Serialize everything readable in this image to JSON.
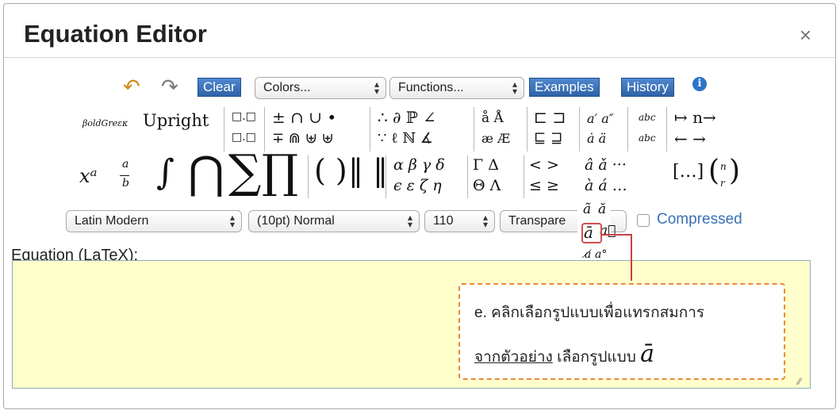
{
  "dialog": {
    "title": "Equation Editor",
    "close_label": "×"
  },
  "toolbar": {
    "undo_icon": "↶",
    "redo_icon": "↷",
    "clear_label": "Clear",
    "colors_label": "Colors...",
    "functions_label": "Functions...",
    "examples_label": "Examples",
    "history_label": "History",
    "info_label": "i"
  },
  "symbols": {
    "bold_greek": "βoldGreεκ",
    "upright": "Upright",
    "row1": {
      "boxes": "□.□",
      "ops1": "± ∩ ∪ •",
      "logic1": "∴ ∂ ℙ ∠",
      "accents1": "å Å",
      "brackets1": "⊏ ⊐",
      "primes": "a′ a″",
      "wide1": "abc",
      "arrows1": "↦ n→"
    },
    "row2": {
      "boxes": "□.□",
      "ops2": "∓ ⋒ ⊎ ⊎",
      "logic2": "∵ ℓ ℕ ∡",
      "accents2": "æ Æ",
      "brackets2": "⊑ ⊒",
      "dots": "ȧ ä",
      "wide2": "abc",
      "arrows2": "← →"
    },
    "big": {
      "power": "xᵃ",
      "frac_num": "a",
      "frac_den": "b",
      "integral": "∫",
      "cap": "⋂",
      "sum": "∑",
      "prod": "∏",
      "parens": "( )",
      "bars": "‖ ‖",
      "greek_top": "α β γ δ",
      "greek_bot": "ϵ ε ζ η",
      "capgreek_top": "Γ Δ",
      "capgreek_bot": "Θ Λ",
      "ineq_top": "< >",
      "ineq_bot": "≤ ≥",
      "acc_top": "â ǎ ···",
      "acc_bot": "à á …",
      "matrix": "[…]",
      "binom_top": "n",
      "binom_bot": "r"
    },
    "popup": {
      "tilde_a": "ã",
      "breve_a": "ă",
      "bar_a": "ā",
      "vec_a": "a⃗",
      "slash_a": "a̸",
      "deg_a": "a°"
    }
  },
  "options": {
    "font": "Latin Modern",
    "size": "(10pt) Normal",
    "dpi": "110",
    "background": "Transpare",
    "compressed_label": "Compressed",
    "compressed_checked": false
  },
  "equation": {
    "label": "Equation (LaTeX):",
    "value": ""
  },
  "callout": {
    "line1": "e. คลิกเลือกรูปแบบเพื่อแทรกสมการ",
    "line2_underlined": "จากตัวอย่าง",
    "line2_rest": " เลือกรูปแบบ ",
    "symbol": "ā"
  },
  "colors": {
    "accent_blue": "#2f63a8",
    "callout_border": "#ed8a2e",
    "highlight_red": "#d05050",
    "editor_bg": "#ffffcc"
  }
}
